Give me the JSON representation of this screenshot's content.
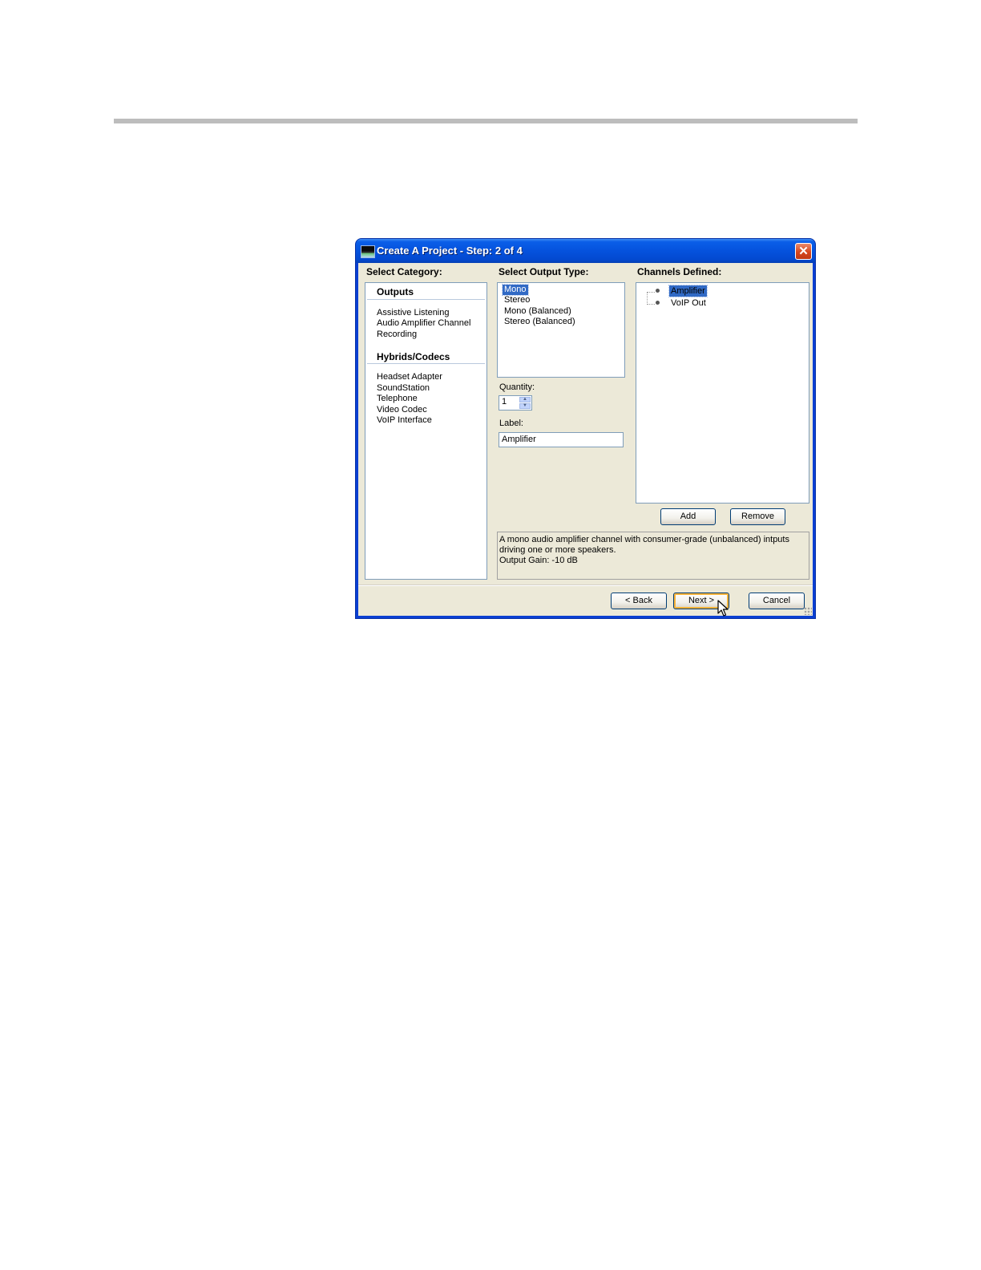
{
  "window": {
    "title": "Create A Project - Step: 2 of 4",
    "close_glyph": "✕",
    "accent_color": "#0a5ee8"
  },
  "category": {
    "label": "Select Category:",
    "groups": [
      {
        "header": "Outputs",
        "items": [
          "Assistive Listening",
          "Audio Amplifier Channel",
          "Recording"
        ]
      },
      {
        "header": "Hybrids/Codecs",
        "items": [
          "Headset Adapter",
          "SoundStation",
          "Telephone",
          "Video Codec",
          "VoIP Interface"
        ]
      }
    ]
  },
  "output_type": {
    "label": "Select Output Type:",
    "items": [
      "Mono",
      "Stereo",
      "Mono (Balanced)",
      "Stereo (Balanced)"
    ],
    "selected": "Mono"
  },
  "quantity": {
    "label": "Quantity:",
    "value": "1"
  },
  "channel_label": {
    "label": "Label:",
    "value": "Amplifier"
  },
  "channels": {
    "label": "Channels Defined:",
    "items": [
      "Amplifier",
      "VoIP Out"
    ],
    "selected": "Amplifier"
  },
  "channel_buttons": {
    "add": "Add",
    "remove": "Remove"
  },
  "description": {
    "line1": "A mono audio amplifier channel with consumer-grade (unbalanced) intputs driving one or more speakers.",
    "line2": "Output Gain: -10 dB"
  },
  "footer": {
    "back": "< Back",
    "next": "Next >",
    "cancel": "Cancel"
  }
}
